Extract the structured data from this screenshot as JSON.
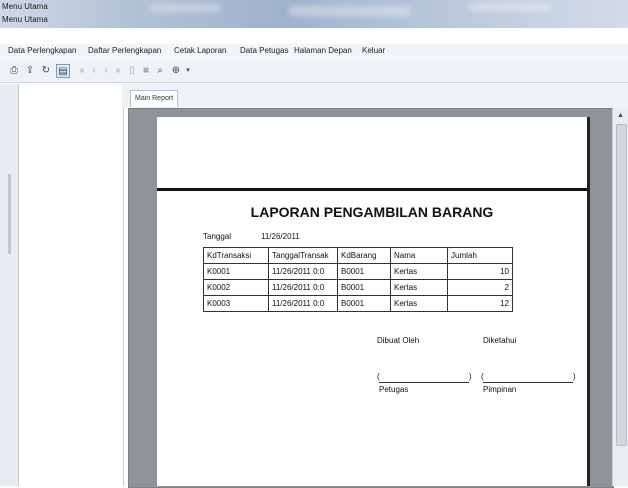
{
  "window": {
    "title": "Menu Utama",
    "subtitle": "Menu Utama"
  },
  "menu": [
    "Data Perlengkapan",
    "Daftar Perlengkapan",
    "Cetak Laporan",
    "Data Petugas",
    "Halaman Depan",
    "Keluar"
  ],
  "toolbar": {
    "icons": [
      "print-icon",
      "export-icon",
      "refresh-icon",
      "tree-toggle-icon",
      "first-page-icon",
      "prev-page-icon",
      "next-page-icon",
      "last-page-icon",
      "goto-page-icon",
      "stop-icon",
      "search-icon",
      "zoom-icon"
    ]
  },
  "tabs": [
    "Main Report"
  ],
  "report": {
    "title": "LAPORAN PENGAMBILAN BARANG",
    "date_label": "Tanggal",
    "date_value": "11/26/2011",
    "columns": [
      "KdTransaksi",
      "TanggalTransak",
      "KdBarang",
      "Nama",
      "Jumlah"
    ],
    "rows": [
      [
        "K0001",
        "11/26/2011  0:0",
        "B0001",
        "Kertas",
        "10"
      ],
      [
        "K0002",
        "11/26/2011  0:0",
        "B0001",
        "Kertas",
        "2"
      ],
      [
        "K0003",
        "11/26/2011  0:0",
        "B0001",
        "Kertas",
        "12"
      ]
    ],
    "signature": {
      "made_by": "Dibuat Oleh",
      "approved_by": "Diketahui",
      "left_open": "(",
      "left_close": ")",
      "right_open": "(",
      "right_close": ")",
      "left_role": "Petugas",
      "right_role": "Pimpinan"
    }
  }
}
